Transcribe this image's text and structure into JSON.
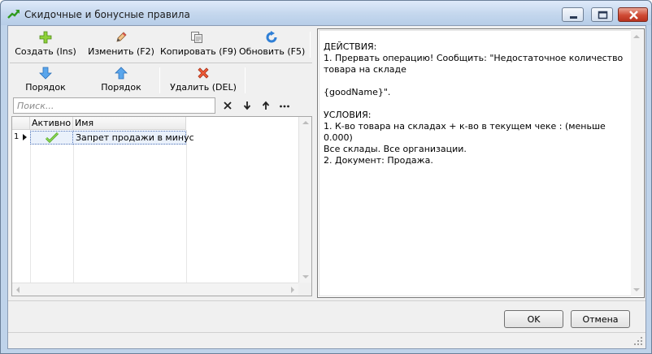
{
  "window": {
    "title": "Скидочные и бонусные правила"
  },
  "toolbar": {
    "create_label": "Создать (Ins)",
    "edit_label": "Изменить (F2)",
    "copy_label": "Копировать (F9)",
    "refresh_label": "Обновить (F5)",
    "order_down_label": "Порядок",
    "order_up_label": "Порядок",
    "delete_label": "Удалить (DEL)"
  },
  "search": {
    "placeholder": "Поиск..."
  },
  "grid": {
    "columns": [
      "Активно",
      "Имя"
    ],
    "rows": [
      {
        "num": "1",
        "active": true,
        "name": "Запрет продажи в минус"
      }
    ]
  },
  "details": {
    "actions_header": "ДЕЙСТВИЯ:",
    "action_1": "1. Прервать операцию! Сообщить: \"Недостаточное количество товара на складе",
    "action_1_cont": "{goodName}\".",
    "conditions_header": "УСЛОВИЯ:",
    "condition_1": "1. К-во товара на складах + к-во в текущем чеке : (меньше 0.000)",
    "condition_1_cont": "Все склады. Все организации.",
    "condition_2": "2. Документ: Продажа."
  },
  "buttons": {
    "ok": "OK",
    "cancel": "Отмена"
  },
  "colors": {
    "check_green": "#5cb82a",
    "delete_red": "#e8401c",
    "arrow_blue": "#3b8fe0"
  }
}
